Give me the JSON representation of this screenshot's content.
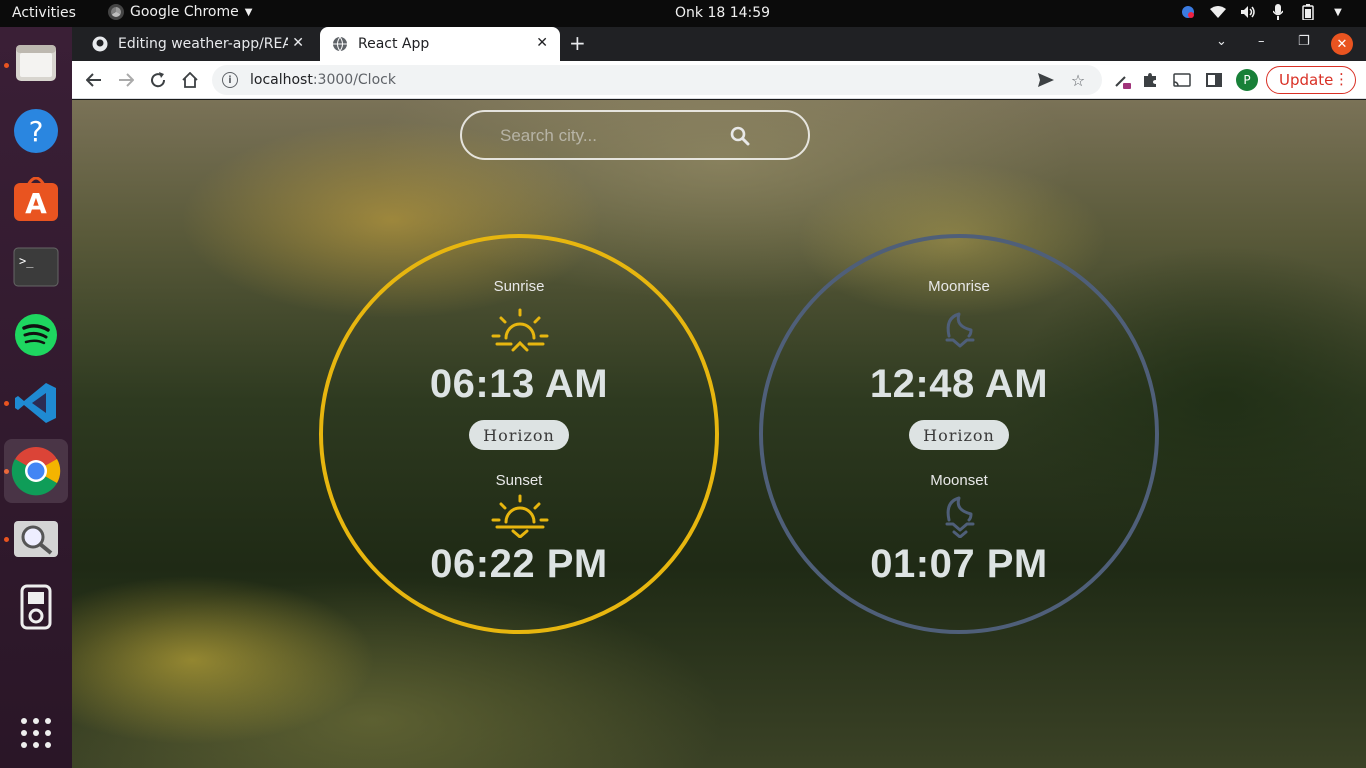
{
  "system": {
    "activities": "Activities",
    "app_menu": "Google Chrome",
    "clock": "Onk 18  14:59"
  },
  "browser": {
    "tabs": [
      {
        "title": "Editing weather-app/REA",
        "active": false
      },
      {
        "title": "React App",
        "active": true
      }
    ],
    "url_host": "localhost",
    "url_path": ":3000/Clock",
    "profile_initial": "P",
    "update_label": "Update"
  },
  "page": {
    "search": {
      "placeholder": "Search city..."
    },
    "sun": {
      "rise_label": "Sunrise",
      "rise_time": "06:13 AM",
      "horizon_label": "Horizon",
      "set_label": "Sunset",
      "set_time": "06:22 PM",
      "color": "#e7b60f"
    },
    "moon": {
      "rise_label": "Moonrise",
      "rise_time": "12:48 AM",
      "horizon_label": "Horizon",
      "set_label": "Moonset",
      "set_time": "01:07 PM",
      "color": "#4f5f79"
    }
  }
}
